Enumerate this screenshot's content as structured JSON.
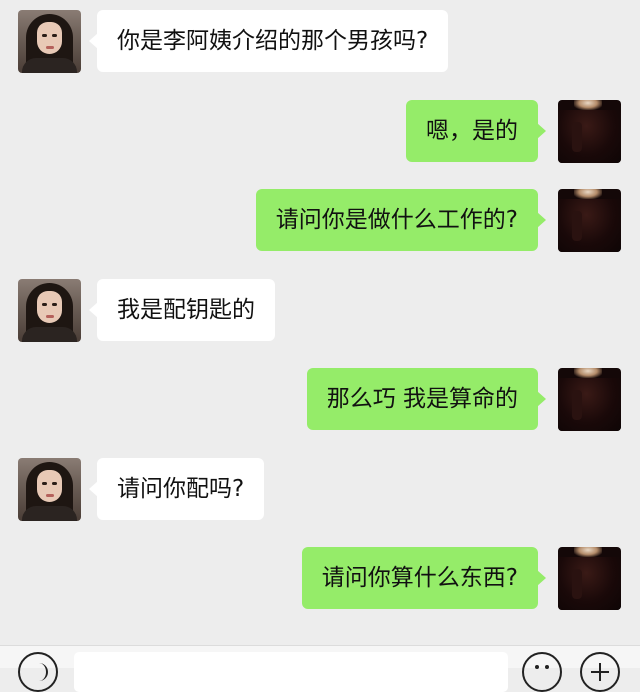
{
  "messages": [
    {
      "side": "left",
      "text": "你是李阿姨介绍的那个男孩吗?"
    },
    {
      "side": "right",
      "text": "嗯，是的"
    },
    {
      "side": "right",
      "text": "请问你是做什么工作的?"
    },
    {
      "side": "left",
      "text": "我是配钥匙的"
    },
    {
      "side": "right",
      "text": "那么巧 我是算命的"
    },
    {
      "side": "left",
      "text": "请问你配吗?"
    },
    {
      "side": "right",
      "text": "请问你算什么东西?"
    }
  ],
  "colors": {
    "background": "#ededed",
    "incoming_bubble": "#ffffff",
    "outgoing_bubble": "#95ec69",
    "text": "#111111"
  },
  "input_bar": {
    "voice_icon": "voice-icon",
    "emoji_icon": "emoji-icon",
    "plus_icon": "plus-icon"
  }
}
